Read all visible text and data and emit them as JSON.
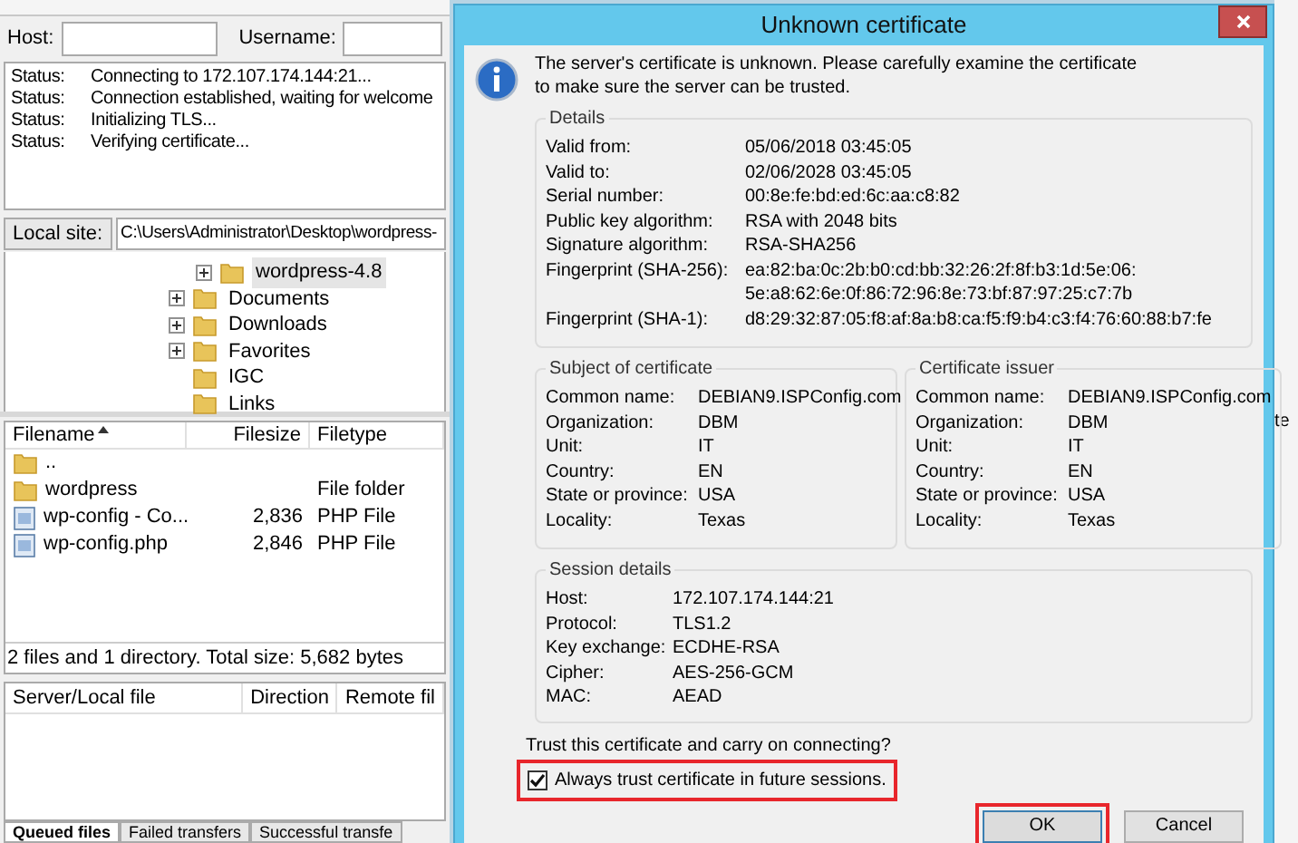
{
  "main_window": {
    "host_label": "Host:",
    "username_label": "Username:",
    "log": [
      {
        "label": "Status:",
        "message": "Connecting to 172.107.174.144:21..."
      },
      {
        "label": "Status:",
        "message": "Connection established, waiting for welcome"
      },
      {
        "label": "Status:",
        "message": "Initializing TLS..."
      },
      {
        "label": "Status:",
        "message": "Verifying certificate..."
      }
    ],
    "local_site_label": "Local site:",
    "local_site_path": "C:\\Users\\Administrator\\Desktop\\wordpress-",
    "tree": [
      {
        "children": [
          {
            "name": "wordpress-4.8",
            "expandable": true,
            "selected": true
          }
        ]
      },
      {
        "name": "Documents",
        "expandable": true,
        "selected": false
      },
      {
        "name": "Downloads",
        "expandable": true,
        "selected": false
      },
      {
        "name": "Favorites",
        "expandable": true,
        "selected": false
      },
      {
        "name": "IGC",
        "expandable": false,
        "selected": false
      },
      {
        "name": "Links",
        "expandable": false,
        "selected": false
      }
    ],
    "file_list": {
      "columns": [
        {
          "label": "Filename",
          "sorted": true
        },
        {
          "label": "Filesize",
          "sorted": false
        },
        {
          "label": "Filetype",
          "sorted": false
        }
      ],
      "rows": [
        {
          "kind": "folder",
          "name": ".."
        },
        {
          "kind": "folder",
          "name": "wordpress",
          "type": "File folder"
        },
        {
          "kind": "file",
          "name": "wp-config - Co...",
          "size": "2,836",
          "type": "PHP File"
        },
        {
          "kind": "file",
          "name": "wp-config.php",
          "size": "2,846",
          "type": "PHP File"
        }
      ],
      "status": "2 files and 1 directory. Total size: 5,682 bytes"
    },
    "queue": {
      "columns": [
        "Server/Local file",
        "Direction",
        "Remote fil"
      ],
      "tabs": [
        {
          "label": "Queued files",
          "selected": true
        },
        {
          "label": "Failed transfers",
          "selected": false
        },
        {
          "label": "Successful transfe",
          "selected": false
        }
      ]
    }
  },
  "right_window": {
    "fragment": "te"
  },
  "dialog": {
    "title": "Unknown certificate",
    "message": "The server's certificate is unknown. Please carefully examine the certificate to make sure the server can be trusted.",
    "details": {
      "title": "Details",
      "rows": [
        {
          "label": "Valid from:",
          "value": "05/06/2018 03:45:05"
        },
        {
          "label": "Valid to:",
          "value": "02/06/2028 03:45:05"
        },
        {
          "label": "Serial number:",
          "value": "00:8e:fe:bd:ed:6c:aa:c8:82"
        },
        {
          "label": "Public key algorithm:",
          "value": "RSA with 2048 bits"
        },
        {
          "label": "Signature algorithm:",
          "value": "RSA-SHA256"
        },
        {
          "label": "Fingerprint (SHA-256):",
          "value_lines": [
            "ea:82:ba:0c:2b:b0:cd:bb:32:26:2f:8f:b3:1d:5e:06:",
            "5e:a8:62:6e:0f:86:72:96:8e:73:bf:87:97:25:c7:7b"
          ]
        },
        {
          "label": "Fingerprint (SHA-1):",
          "value": "d8:29:32:87:05:f8:af:8a:b8:ca:f5:f9:b4:c3:f4:76:60:88:b7:fe"
        }
      ]
    },
    "subject": {
      "title": "Subject of certificate",
      "rows": [
        {
          "label": "Common name:",
          "value": "DEBIAN9.ISPConfig.com"
        },
        {
          "label": "Organization:",
          "value": "DBM"
        },
        {
          "label": "Unit:",
          "value": "IT"
        },
        {
          "label": "Country:",
          "value": "EN"
        },
        {
          "label": "State or province:",
          "value": "USA"
        },
        {
          "label": "Locality:",
          "value": "Texas"
        }
      ]
    },
    "issuer": {
      "title": "Certificate issuer",
      "rows": [
        {
          "label": "Common name:",
          "value": "DEBIAN9.ISPConfig.com"
        },
        {
          "label": "Organization:",
          "value": "DBM"
        },
        {
          "label": "Unit:",
          "value": "IT"
        },
        {
          "label": "Country:",
          "value": "EN"
        },
        {
          "label": "State or province:",
          "value": "USA"
        },
        {
          "label": "Locality:",
          "value": "Texas"
        }
      ]
    },
    "session": {
      "title": "Session details",
      "rows": [
        {
          "label": "Host:",
          "value": "172.107.174.144:21"
        },
        {
          "label": "Protocol:",
          "value": "TLS1.2"
        },
        {
          "label": "Key exchange:",
          "value": "ECDHE-RSA"
        },
        {
          "label": "Cipher:",
          "value": "AES-256-GCM"
        },
        {
          "label": "MAC:",
          "value": "AEAD"
        }
      ]
    },
    "question": "Trust this certificate and carry on connecting?",
    "always_trust": {
      "label": "Always trust certificate in future sessions.",
      "checked": true,
      "highlighted": true
    },
    "buttons": [
      {
        "label": "OK",
        "highlighted": true
      },
      {
        "label": "Cancel",
        "highlighted": false
      }
    ]
  }
}
